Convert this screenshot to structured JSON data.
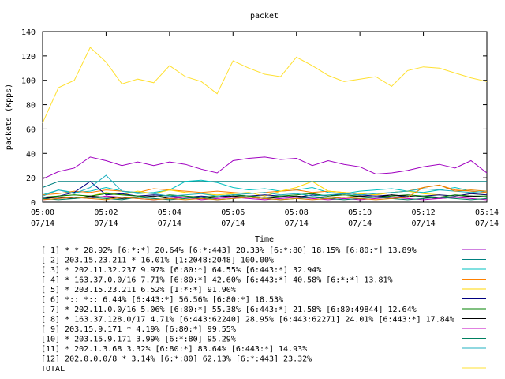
{
  "chart_data": {
    "type": "line",
    "title": "packet",
    "xlabel": "Time",
    "ylabel": "packets (Kpps)",
    "ylim": [
      0,
      140
    ],
    "yticks": [
      0,
      20,
      40,
      60,
      80,
      100,
      120,
      140
    ],
    "xlim": [
      0,
      28
    ],
    "xticks": [
      {
        "x": 0,
        "line1": "05:00",
        "line2": "07/14"
      },
      {
        "x": 4,
        "line1": "05:02",
        "line2": "07/14"
      },
      {
        "x": 8,
        "line1": "05:04",
        "line2": "07/14"
      },
      {
        "x": 12,
        "line1": "05:06",
        "line2": "07/14"
      },
      {
        "x": 16,
        "line1": "05:08",
        "line2": "07/14"
      },
      {
        "x": 20,
        "line1": "05:10",
        "line2": "07/14"
      },
      {
        "x": 24,
        "line1": "05:12",
        "line2": "07/14"
      },
      {
        "x": 28,
        "line1": "05:14",
        "line2": "07/14"
      }
    ],
    "grid": false,
    "legend_position": "bottom",
    "x": [
      0,
      1,
      2,
      3,
      4,
      5,
      6,
      7,
      8,
      9,
      10,
      11,
      12,
      13,
      14,
      15,
      16,
      17,
      18,
      19,
      20,
      21,
      22,
      23,
      24,
      25,
      26,
      27,
      28
    ],
    "series": [
      {
        "name": "[ 1] * * 28.92%  [6:*:*] 20.64% [6:*:443] 20.33% [6:*:80] 18.15% [6:80:*] 13.89%",
        "color": "#a000c0",
        "values": [
          19,
          25,
          28,
          37,
          34,
          30,
          33,
          30,
          33,
          31,
          27,
          24,
          34,
          36,
          37,
          35,
          36,
          30,
          34,
          31,
          29,
          23,
          24,
          26,
          29,
          31,
          28,
          34,
          24
        ]
      },
      {
        "name": "[ 2] 203.15.23.211 * 16.01%  [1:2048:2048] 100.00%",
        "color": "#008080",
        "values": [
          12,
          17,
          17,
          17,
          17,
          17,
          17,
          17,
          17,
          17,
          17,
          17,
          17,
          17,
          17,
          17,
          17,
          17,
          17,
          17,
          17,
          17,
          17,
          17,
          17,
          17,
          17,
          17,
          17
        ]
      },
      {
        "name": "[ 3] * 202.11.32.237 9.97%  [6:80:*] 64.55% [6:443:*] 32.94%",
        "color": "#00c0c0",
        "values": [
          6,
          10,
          8,
          9,
          12,
          9,
          7,
          8,
          10,
          17,
          18,
          16,
          12,
          10,
          11,
          9,
          10,
          12,
          8,
          7,
          9,
          10,
          11,
          9,
          8,
          10,
          12,
          9,
          8
        ]
      },
      {
        "name": "[ 4] * 163.37.0.0/16 7.71%  [6:80:*] 42.60% [6:443:*] 40.58% [6:*:*] 13.81%",
        "color": "#ff8000",
        "values": [
          6,
          7,
          9,
          8,
          10,
          9,
          8,
          11,
          10,
          9,
          8,
          9,
          8,
          7,
          8,
          9,
          10,
          8,
          9,
          8,
          7,
          6,
          8,
          9,
          12,
          14,
          10,
          9,
          8
        ]
      },
      {
        "name": "[ 5] * 203.15.23.211 6.52%  [1:*:*] 91.90%",
        "color": "#ffd700",
        "values": [
          4,
          5,
          6,
          5,
          8,
          6,
          9,
          7,
          10,
          8,
          7,
          6,
          7,
          8,
          5,
          9,
          12,
          17,
          9,
          8,
          7,
          6,
          8,
          9,
          7,
          6,
          5,
          7,
          6
        ]
      },
      {
        "name": "[ 6] *:: *:: 6.44%  [6:443:*] 56.56% [6:80:*] 18.53%",
        "color": "#000080",
        "values": [
          3,
          5,
          8,
          17,
          6,
          7,
          5,
          6,
          5,
          4,
          5,
          4,
          6,
          5,
          6,
          5,
          4,
          6,
          5,
          7,
          6,
          5,
          6,
          4,
          5,
          6,
          5,
          7,
          6
        ]
      },
      {
        "name": "[ 7] * 202.11.0.0/16 5.06%  [6:80:*] 55.38% [6:443:*] 21.58% [6:80:49844] 12.64%",
        "color": "#008000",
        "values": [
          4,
          5,
          6,
          5,
          7,
          6,
          5,
          4,
          6,
          5,
          4,
          5,
          6,
          5,
          4,
          5,
          6,
          7,
          5,
          6,
          5,
          4,
          5,
          6,
          5,
          4,
          6,
          5,
          5
        ]
      },
      {
        "name": "[ 8] * 163.37.128.0/17 4.71%  [6:443:62240] 28.95% [6:443:62271] 24.01% [6:443:*] 17.84%",
        "color": "#000000",
        "values": [
          3,
          4,
          3,
          5,
          4,
          3,
          4,
          5,
          3,
          4,
          3,
          4,
          5,
          4,
          3,
          4,
          5,
          4,
          3,
          4,
          5,
          4,
          6,
          5,
          4,
          3,
          4,
          5,
          4
        ]
      },
      {
        "name": "[ 9] 203.15.9.171 * 4.19%  [6:80:*] 99.55%",
        "color": "#c000c0",
        "values": [
          2,
          3,
          4,
          3,
          5,
          4,
          3,
          2,
          3,
          4,
          2,
          3,
          4,
          3,
          2,
          3,
          4,
          3,
          2,
          3,
          2,
          3,
          4,
          3,
          2,
          3,
          4,
          3,
          2
        ]
      },
      {
        "name": "[10] * 203.15.9.171 3.99%  [6:*:80] 95.29%",
        "color": "#008060",
        "values": [
          3,
          2,
          3,
          4,
          3,
          2,
          4,
          3,
          2,
          3,
          4,
          2,
          3,
          4,
          3,
          2,
          3,
          4,
          3,
          2,
          3,
          4,
          3,
          2,
          3,
          4,
          3,
          2,
          3
        ]
      },
      {
        "name": "[11] * 202.1.3.68 3.32%  [6:80:*] 83.64% [6:443:*] 14.93%",
        "color": "#20b0c0",
        "values": [
          5,
          10,
          7,
          12,
          22,
          9,
          8,
          7,
          5,
          6,
          7,
          5,
          6,
          7,
          8,
          6,
          7,
          5,
          6,
          7,
          6,
          7,
          8,
          9,
          11,
          10,
          9,
          8,
          9
        ]
      },
      {
        "name": "[12] 202.0.0.0/8 * 3.14%  [6:*:80] 62.13% [6:*:443] 23.32%",
        "color": "#e08000",
        "values": [
          2,
          3,
          4,
          3,
          2,
          4,
          3,
          2,
          3,
          2,
          3,
          2,
          3,
          4,
          3,
          2,
          3,
          2,
          3,
          4,
          3,
          2,
          3,
          4,
          12,
          14,
          9,
          10,
          9
        ]
      },
      {
        "name": "TOTAL",
        "color": "#ffe030",
        "values": [
          65,
          94,
          100,
          127,
          115,
          97,
          101,
          98,
          112,
          103,
          99,
          89,
          116,
          110,
          105,
          103,
          119,
          112,
          104,
          99,
          101,
          103,
          95,
          108,
          111,
          110,
          106,
          102,
          99
        ]
      }
    ]
  }
}
